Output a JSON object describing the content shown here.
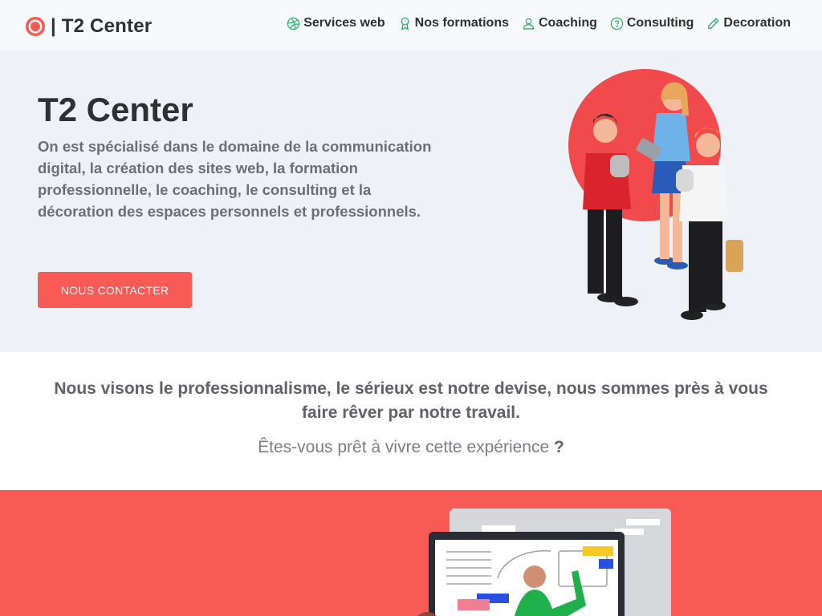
{
  "brand": {
    "logo_icon": "target-icon",
    "text": "| T2 Center",
    "accent": "#f85a56"
  },
  "nav": {
    "items": [
      {
        "label": "Services web",
        "icon": "dribbble-icon"
      },
      {
        "label": "Nos formations",
        "icon": "award-icon"
      },
      {
        "label": "Coaching",
        "icon": "user-icon"
      },
      {
        "label": "Consulting",
        "icon": "help-circle-icon"
      },
      {
        "label": "Decoration",
        "icon": "pencil-icon"
      }
    ],
    "icon_color": "#3cb371"
  },
  "hero": {
    "title": "T2 Center",
    "description": "On est spécialisé dans le domaine de la communication digital, la création des sites web, la formation professionnelle, le coaching, le consulting et la décoration des espaces personnels et professionnels.",
    "cta_label": "NOUS CONTACTER",
    "background": "#eef2f6"
  },
  "tagline": {
    "main": "Nous visons le professionnalisme, le sérieux est notre devise, nous sommes près à vous faire rêver par notre travail.",
    "sub": "Êtes-vous prêt à vivre cette expérience ",
    "sub_mark": "?"
  },
  "section": {
    "background": "#f85a56"
  }
}
